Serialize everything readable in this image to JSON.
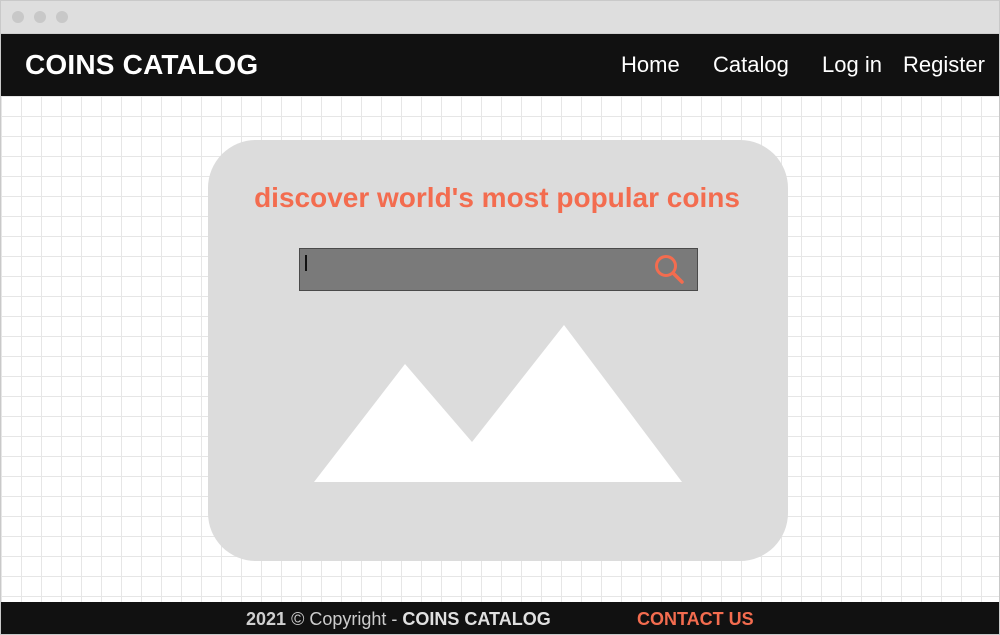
{
  "navbar": {
    "brand": "COINS CATALOG",
    "links": [
      {
        "label": "Home"
      },
      {
        "label": "Catalog"
      },
      {
        "label": "Log in"
      },
      {
        "label": "Register"
      }
    ]
  },
  "hero": {
    "tagline": "discover world's most popular coins",
    "search": {
      "value": "",
      "placeholder": ""
    },
    "background_icon": "image-placeholder-icon"
  },
  "footer": {
    "year": "2021",
    "copyright": "© Copyright -",
    "brand": "COINS CATALOG",
    "contact": "CONTACT US"
  },
  "colors": {
    "accent": "#f36c4f",
    "navbar_bg": "#111111",
    "card_bg": "#dcdcdc",
    "search_bg": "#7a7a7a"
  },
  "icons": {
    "search": "search-icon"
  }
}
